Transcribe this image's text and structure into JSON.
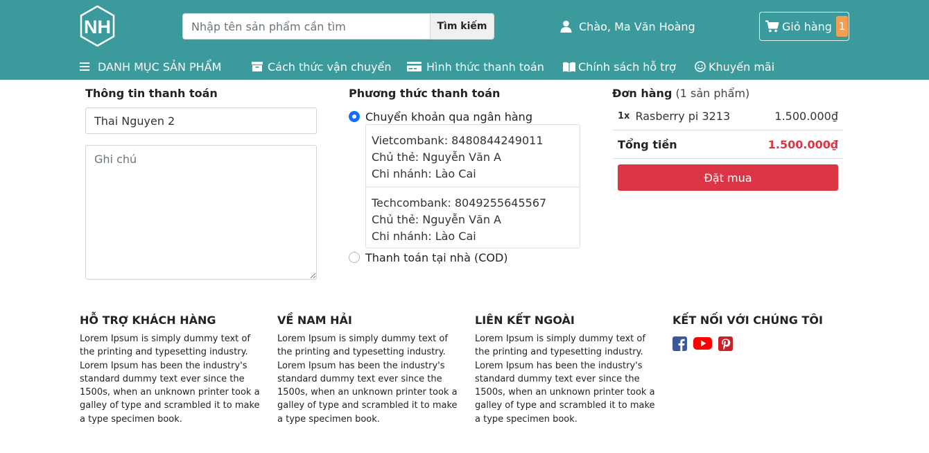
{
  "header": {
    "logo_text": "NH",
    "search": {
      "placeholder": "Nhập tên sản phẩm cần tìm",
      "value": "",
      "button": "Tìm kiếm"
    },
    "greeting": "Chào, Ma Văn Hoàng",
    "cart": {
      "label": "Giỏ hàng",
      "count": "1"
    }
  },
  "nav": {
    "categories": "DANH MỤC SẢN PHẨM",
    "shipping": "Cách thức vận chuyển",
    "payment": "Hình thức thanh toán",
    "support": "Chính sách hỗ trợ",
    "promotion": "Khuyến mãi"
  },
  "billing": {
    "title": "Thông tin thanh toán",
    "address_value": "Thai Nguyen 2",
    "note_placeholder": "Ghi chú"
  },
  "payment_method": {
    "title": "Phương thức thanh toán",
    "option_bank": "Chuyển khoản qua ngân hàng",
    "banks": [
      {
        "account": "Vietcombank: 8480844249011",
        "holder": "Chủ thẻ: Nguyễn Văn A",
        "branch": "Chi nhánh: Lào Cai"
      },
      {
        "account": "Techcombank: 8049255645567",
        "holder": "Chủ thẻ: Nguyễn Văn A",
        "branch": "Chi nhánh: Lào Cai"
      }
    ],
    "option_cod": "Thanh toán tại nhà (COD)",
    "selected": "bank"
  },
  "order": {
    "title": "Đơn hàng",
    "count": "(1 sản phẩm)",
    "items": [
      {
        "qty": "1x",
        "name": "Rasberry pi 3213",
        "price": "1.500.000₫"
      }
    ],
    "total_label": "Tổng tiền",
    "total_value": "1.500.000₫",
    "button": "Đặt mua"
  },
  "footer": {
    "support": {
      "title": "HỖ TRỢ KHÁCH HÀNG",
      "text": "Lorem Ipsum is simply dummy text of the printing and typesetting industry. Lorem Ipsum has been the industry's standard dummy text ever since the 1500s, when an unknown printer took a galley of type and scrambled it to make a type specimen book."
    },
    "about": {
      "title": "VỀ NAM HẢI",
      "text": "Lorem Ipsum is simply dummy text of the printing and typesetting industry. Lorem Ipsum has been the industry's standard dummy text ever since the 1500s, when an unknown printer took a galley of type and scrambled it to make a type specimen book."
    },
    "links": {
      "title": "LIÊN KẾT NGOÀI",
      "text": "Lorem Ipsum is simply dummy text of the printing and typesetting industry. Lorem Ipsum has been the industry's standard dummy text ever since the 1500s, when an unknown printer took a galley of type and scrambled it to make a type specimen book."
    },
    "connect": {
      "title": "KẾT NỐI VỚI CHÚNG TÔI",
      "icons": [
        "facebook-icon",
        "youtube-icon",
        "pinterest-icon"
      ]
    }
  },
  "colors": {
    "header_bg": "#3a9a9c",
    "cart_badge": "#f0a050",
    "primary_button": "#dc3545",
    "total_price": "#dc3545",
    "radio_checked": "#0d6efd",
    "facebook": "#3b5998",
    "youtube": "#ff0000",
    "pinterest": "#cb2027"
  }
}
